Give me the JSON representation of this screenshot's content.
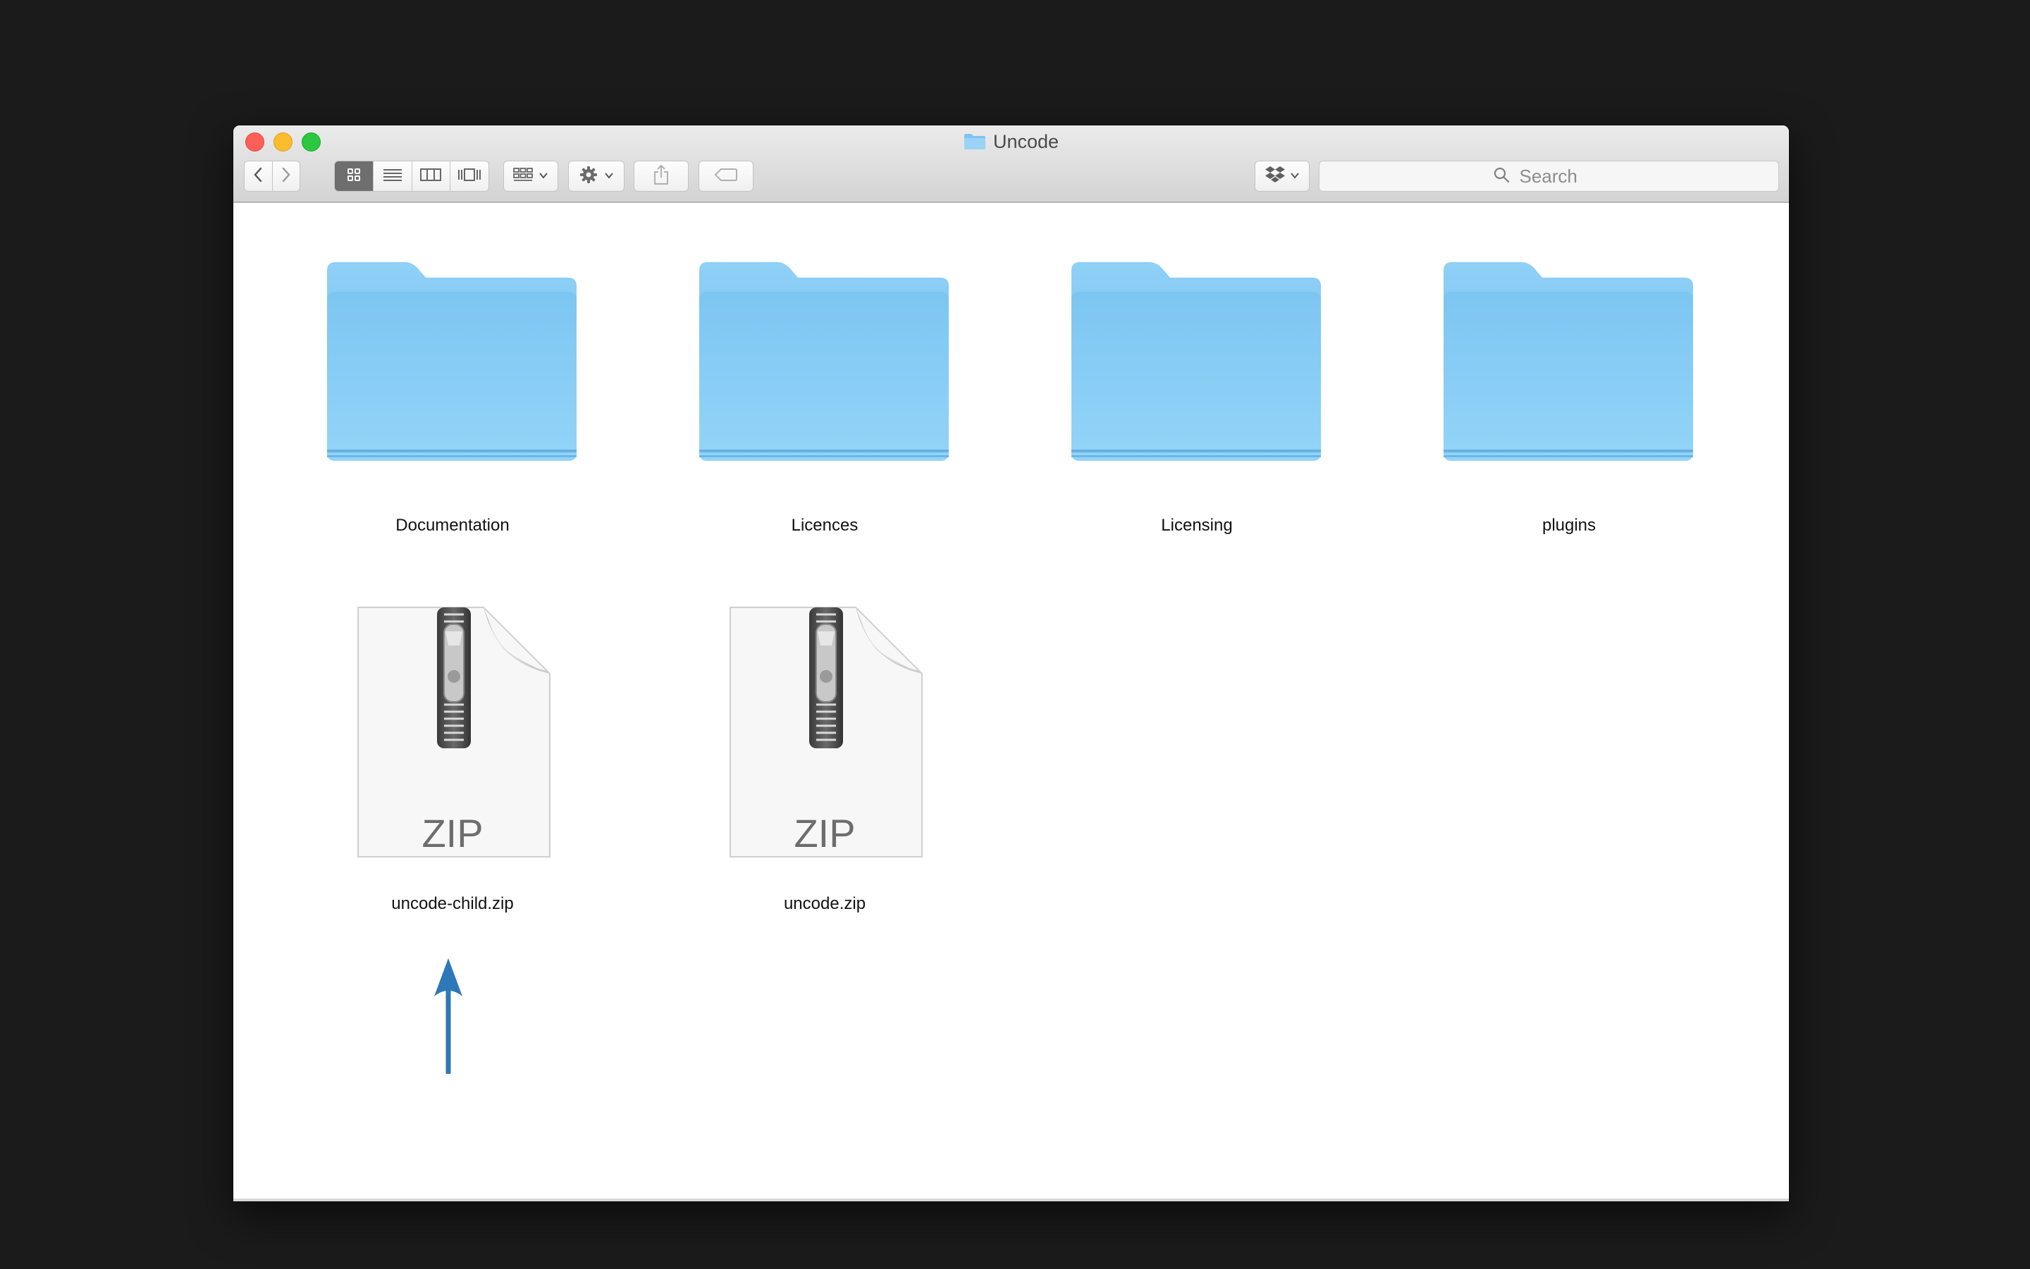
{
  "window": {
    "title": "Uncode"
  },
  "toolbar": {
    "back_icon": "chevron-left-icon",
    "forward_icon": "chevron-right-icon",
    "views": [
      "icon-view",
      "list-view",
      "column-view",
      "cover-flow-view"
    ],
    "active_view": "icon-view",
    "group_icon": "group-by-icon",
    "action_icon": "gear-icon",
    "share_icon": "share-icon",
    "tag_icon": "tag-icon",
    "dropbox_icon": "dropbox-icon"
  },
  "search": {
    "placeholder": "Search"
  },
  "files": [
    {
      "name": "Documentation",
      "kind": "folder"
    },
    {
      "name": "Licences",
      "kind": "folder"
    },
    {
      "name": "Licensing",
      "kind": "folder"
    },
    {
      "name": "plugins",
      "kind": "folder"
    },
    {
      "name": "uncode-child.zip",
      "kind": "zip",
      "badge": "ZIP"
    },
    {
      "name": "uncode.zip",
      "kind": "zip",
      "badge": "ZIP"
    }
  ],
  "annotation": {
    "arrow_color": "#2f78b7",
    "points_to": "uncode-child.zip"
  },
  "colors": {
    "folder_light": "#a6d8f7",
    "folder_dark": "#74c1f0",
    "desktop": "#1b1b1b"
  }
}
